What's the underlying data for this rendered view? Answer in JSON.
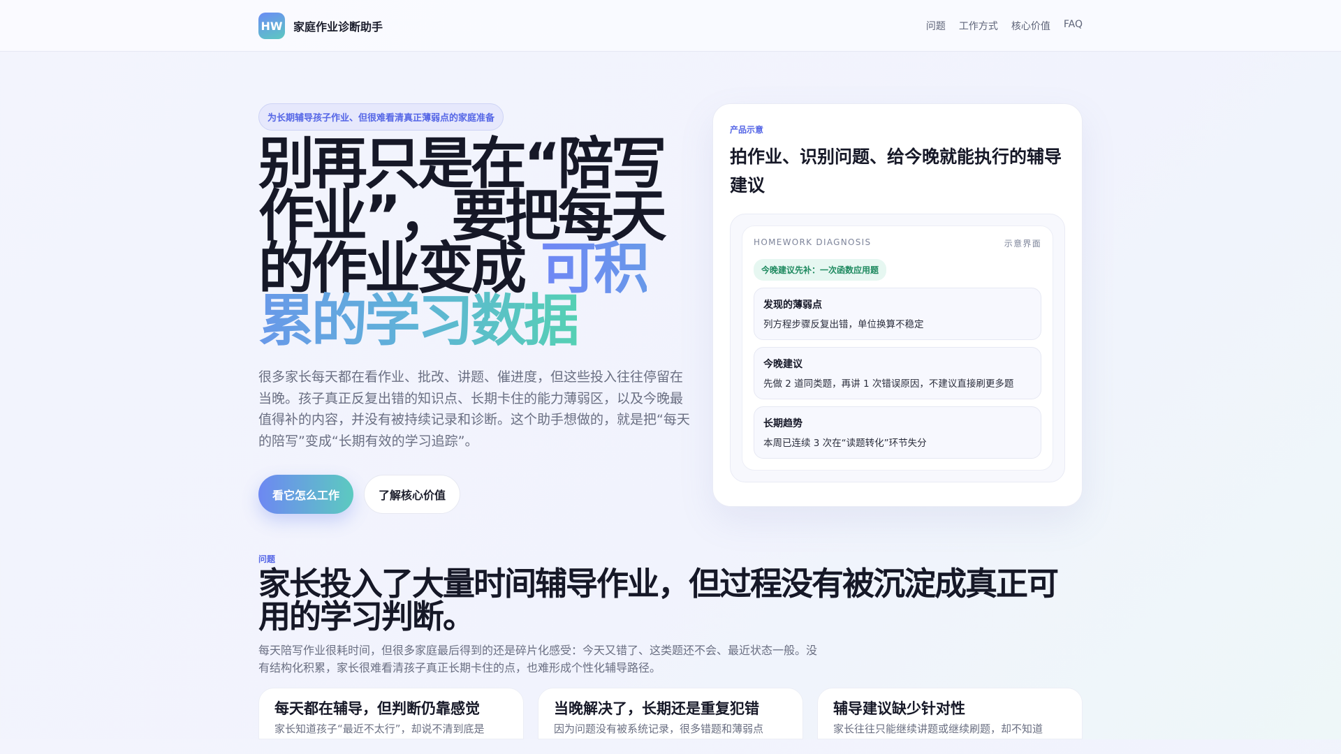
{
  "nav": {
    "logo": "HW",
    "brand": "家庭作业诊断助手",
    "links": [
      "问题",
      "工作方式",
      "核心价值",
      "FAQ"
    ]
  },
  "hero": {
    "pill": "为长期辅导孩子作业、但很难看清真正薄弱点的家庭准备",
    "title_plain": "别再只是在“陪写作业”，要把每天的作业变成 ",
    "title_accent": "可积累的学习数据",
    "lead": "很多家长每天都在看作业、批改、讲题、催进度，但这些投入往往停留在当晚。孩子真正反复出错的知识点、长期卡住的能力薄弱区，以及今晚最值得补的内容，并没有被持续记录和诊断。这个助手想做的，就是把“每天的陪写”变成“长期有效的学习追踪”。",
    "primary_button": "看它怎么工作",
    "secondary_button": "了解核心价值"
  },
  "demo": {
    "eyebrow": "产品示意",
    "title": "拍作业、识别问题、给今晚就能执行的辅导建议",
    "panel_title": "HOMEWORK DIAGNOSIS",
    "panel_note": "示意界面",
    "tag": "今晚建议先补：一次函数应用题",
    "items": [
      {
        "title": "发现的薄弱点",
        "text": "列方程步骤反复出错，单位换算不稳定"
      },
      {
        "title": "今晚建议",
        "text": "先做 2 道同类题，再讲 1 次错误原因，不建议直接刷更多题"
      },
      {
        "title": "长期趋势",
        "text": "本周已连续 3 次在“读题转化”环节失分"
      }
    ]
  },
  "problem": {
    "eyebrow": "问题",
    "title": "家长投入了大量时间辅导作业，但过程没有被沉淀成真正可用的学习判断。",
    "text": "每天陪写作业很耗时间，但很多家庭最后得到的还是碎片化感受：今天又错了、这类题还不会、最近状态一般。没有结构化积累，家长很难看清孩子真正长期卡住的点，也难形成个性化辅导路径。",
    "cards": [
      {
        "title": "每天都在辅导，但判断仍靠感觉",
        "text": "家长知道孩子“最近不太行”，却说不清到底是"
      },
      {
        "title": "当晚解决了，长期还是重复犯错",
        "text": "因为问题没有被系统记录，很多错题和薄弱点"
      },
      {
        "title": "辅导建议缺少针对性",
        "text": "家长往往只能继续讲题或继续刷题，却不知道"
      }
    ]
  }
}
